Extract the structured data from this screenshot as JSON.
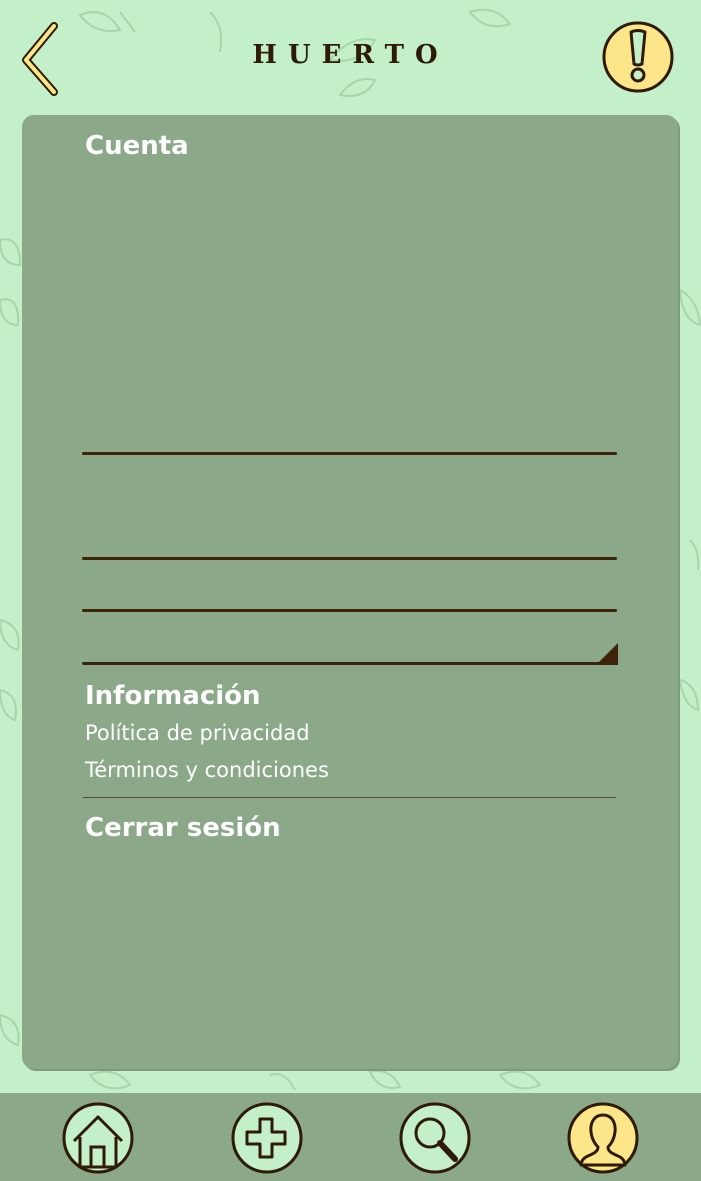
{
  "header": {
    "title": "HUERTO",
    "back_icon": "chevron-left-icon",
    "alert_icon": "exclamation-icon"
  },
  "account": {
    "title": "Cuenta"
  },
  "info": {
    "title": "Información",
    "links": [
      "Política de privacidad",
      "Términos y condiciones"
    ]
  },
  "logout": {
    "label": "Cerrar sesión"
  },
  "nav": {
    "items": [
      "home-icon",
      "plus-icon",
      "search-icon",
      "profile-icon"
    ]
  },
  "colors": {
    "background": "#c3f0c8",
    "panel": "#8ba888",
    "accent_yellow": "#fde68a",
    "dark_brown": "#2e1a06"
  }
}
